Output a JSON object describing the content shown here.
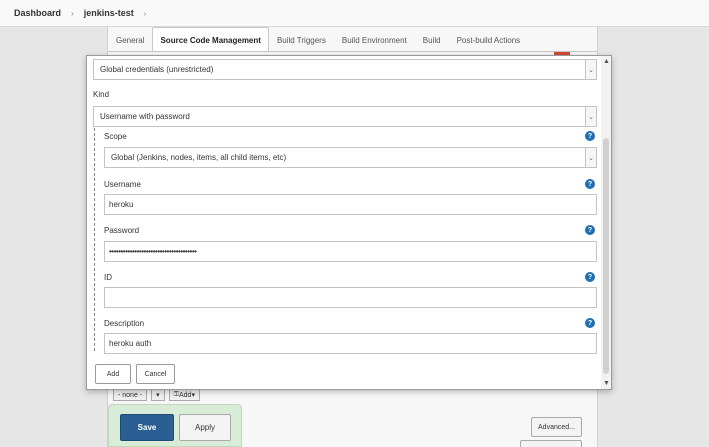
{
  "breadcrumb": {
    "items": [
      "Dashboard",
      "jenkins-test"
    ],
    "separator": "›"
  },
  "tabs": [
    {
      "label": "General",
      "active": false
    },
    {
      "label": "Source Code Management",
      "active": true
    },
    {
      "label": "Build Triggers",
      "active": false
    },
    {
      "label": "Build Environment",
      "active": false
    },
    {
      "label": "Build",
      "active": false
    },
    {
      "label": "Post-build Actions",
      "active": false
    }
  ],
  "modal": {
    "domain_value": "Global credentials (unrestricted)",
    "kind_label": "Kind",
    "kind_value": "Username with password",
    "scope_label": "Scope",
    "scope_value": "Global (Jenkins, nodes, items, all child items, etc)",
    "username_label": "Username",
    "username_value": "heroku",
    "password_label": "Password",
    "password_value": "••••••••••••••••••••••••••••••••••••••",
    "id_label": "ID",
    "id_value": "",
    "description_label": "Description",
    "description_value": "heroku auth",
    "add_label": "Add",
    "cancel_label": "Cancel"
  },
  "background": {
    "none_label": "- none -",
    "add_label": "Add",
    "save_label": "Save",
    "apply_label": "Apply",
    "advanced_label": "Advanced..."
  },
  "icons": {
    "help": "help-icon",
    "dropdown": "chevron-down-icon",
    "scroll_up": "scroll-up-arrow",
    "scroll_down": "scroll-down-arrow"
  },
  "colors": {
    "help": "#1f6fb5",
    "save_button": "#2b5f94",
    "save_area": "#d9ecd8",
    "accent_red": "#d24939"
  }
}
